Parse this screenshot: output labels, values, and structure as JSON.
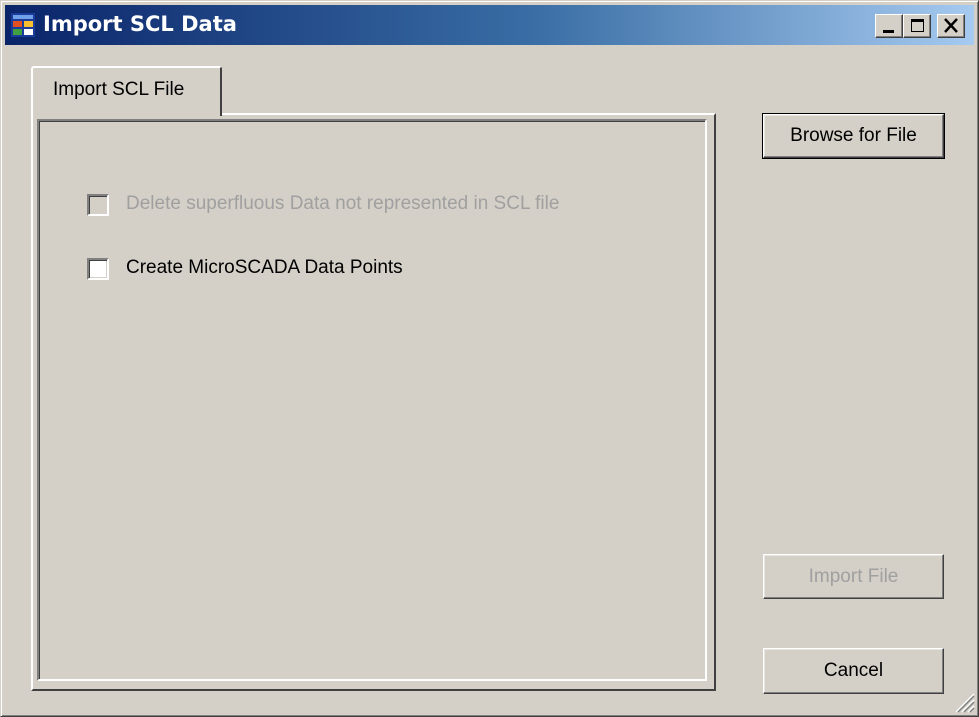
{
  "window": {
    "title": "Import SCL Data",
    "icon": "app-window-icon",
    "controls": [
      "minimize-icon",
      "maximize-icon",
      "close-icon"
    ]
  },
  "tabs": [
    {
      "label": "Import SCL File",
      "selected": true
    }
  ],
  "options": {
    "delete_superfluous": {
      "label": "Delete superfluous Data not represented in SCL file",
      "checked": false,
      "enabled": false
    },
    "create_points": {
      "label": "Create MicroSCADA Data Points",
      "checked": false,
      "enabled": true
    }
  },
  "buttons": {
    "browse": {
      "label": "Browse for File",
      "enabled": true
    },
    "import": {
      "label": "Import File",
      "enabled": false
    },
    "cancel": {
      "label": "Cancel",
      "enabled": true
    }
  },
  "colors": {
    "face": "#d4d0c8",
    "title_start": "#0a246a",
    "title_end": "#a6caf0",
    "disabled_text": "#a0a0a0"
  }
}
